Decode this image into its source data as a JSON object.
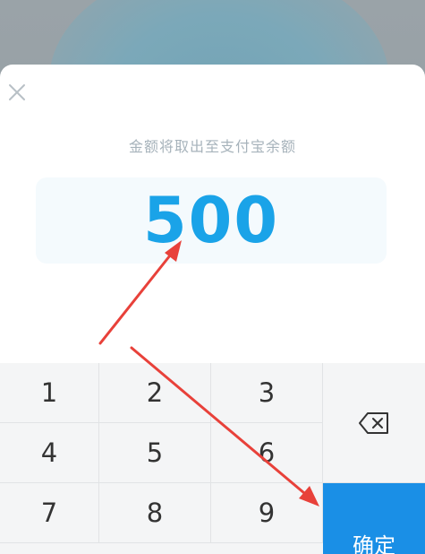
{
  "dialog": {
    "subtitle": "金额将取出至支付宝余额",
    "amount": "500"
  },
  "keypad": {
    "keys": [
      "1",
      "2",
      "3",
      "4",
      "5",
      "6",
      "7",
      "8",
      "9"
    ],
    "confirm_label": "确定"
  },
  "icons": {
    "close": "close-icon",
    "backspace": "backspace-icon",
    "arrows": "annotation-arrow"
  },
  "colors": {
    "accent": "#1a8fe6",
    "amount_text": "#1aa3e8",
    "annotation": "#e8413a"
  }
}
